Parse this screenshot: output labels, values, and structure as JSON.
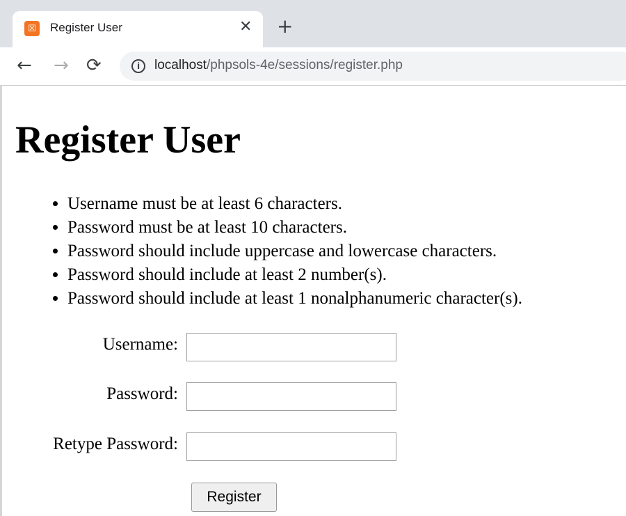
{
  "browser": {
    "tab": {
      "title": "Register User",
      "favicon": "xampp-icon",
      "close_glyph": "✕"
    },
    "new_tab_glyph": "+",
    "nav": {
      "back_glyph": "←",
      "forward_glyph": "→",
      "reload_glyph": "⟳"
    },
    "address": {
      "info_glyph": "i",
      "host": "localhost",
      "path": "/phpsols-4e/sessions/register.php"
    }
  },
  "page": {
    "heading": "Register User",
    "rules": [
      "Username must be at least 6 characters.",
      "Password must be at least 10 characters.",
      "Password should include uppercase and lowercase characters.",
      "Password should include at least 2 number(s).",
      "Password should include at least 1 nonalphanumeric character(s)."
    ],
    "form": {
      "username_label": "Username:",
      "username_value": "",
      "password_label": "Password:",
      "password_value": "",
      "retype_label": "Retype Password:",
      "retype_value": "",
      "submit_label": "Register"
    }
  },
  "colors": {
    "tabstrip": "#dee1e6",
    "favicon": "#f37524",
    "omnibox": "#f1f3f4"
  }
}
